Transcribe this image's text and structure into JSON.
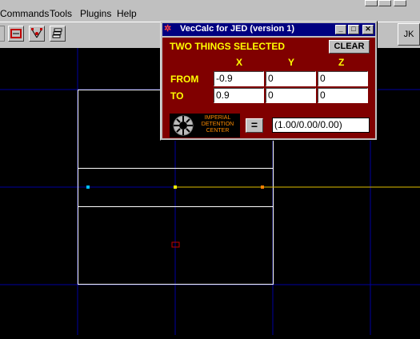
{
  "host": {
    "menu": [
      {
        "label": "Commands"
      },
      {
        "label": "Tools"
      },
      {
        "label": "Plugins"
      },
      {
        "label": "Help"
      }
    ],
    "title_fragment": "Jed",
    "right_button": "JK"
  },
  "dialog": {
    "title": "VecCalc for JED (version 1)",
    "heading": "TWO THINGS SELECTED",
    "clear_label": "CLEAR",
    "columns": [
      "X",
      "Y",
      "Z"
    ],
    "rows": [
      {
        "label": "FROM",
        "x": "-0.9",
        "y": "0",
        "z": "0"
      },
      {
        "label": "TO",
        "x": "0.9",
        "y": "0",
        "z": "0"
      }
    ],
    "logo_text": [
      "IMPERIAL",
      "DETENTION",
      "CENTER"
    ],
    "equals_label": "=",
    "result": "(1.00/0.00/0.00)"
  },
  "colors": {
    "dialog_background": "#800000",
    "label_color": "#ffff00",
    "titlebar": "#000080",
    "grid_line": "#0000a0",
    "selection_line": "#ffff00",
    "shape_outline": "#ffffff"
  }
}
